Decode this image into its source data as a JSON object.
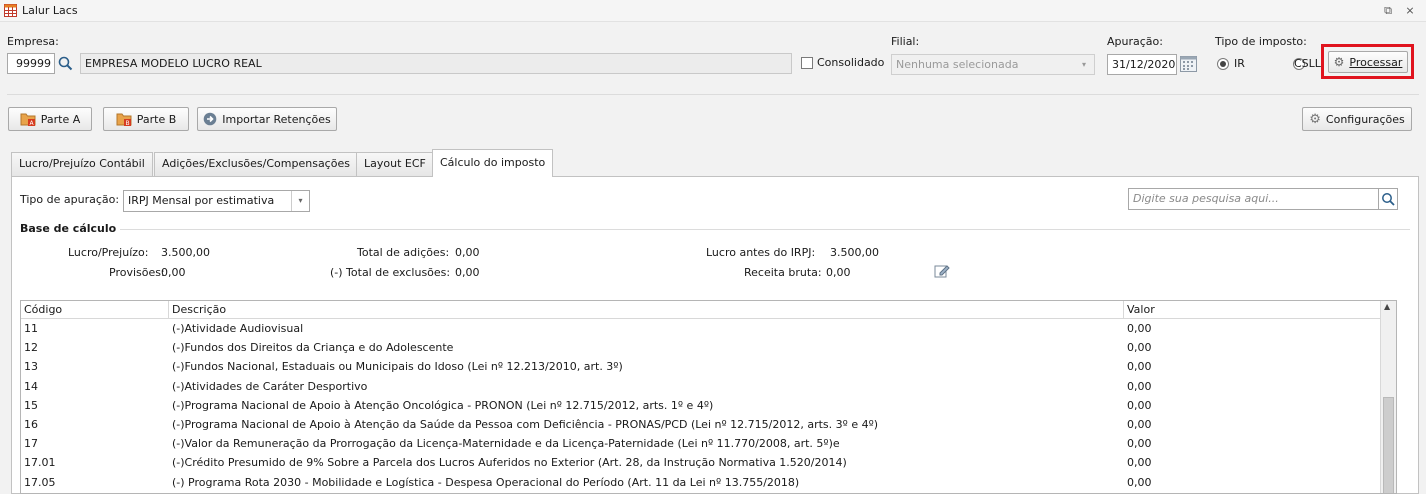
{
  "window": {
    "title": "Lalur Lacs",
    "restore_glyph": "⧉",
    "close_glyph": "⨯"
  },
  "header": {
    "empresa_label": "Empresa:",
    "empresa_code": "99999",
    "empresa_name": "EMPRESA MODELO LUCRO REAL",
    "consolidado_label": "Consolidado",
    "filial_label": "Filial:",
    "filial_placeholder": "Nenhuma selecionada",
    "apuracao_label": "Apuração:",
    "apuracao_value": "31/12/2020",
    "tipo_imposto_label": "Tipo de imposto:",
    "radio_ir": "IR",
    "radio_csll": "CSLL",
    "processar_label": "Processar"
  },
  "toolbar": {
    "parte_a": "Parte A",
    "parte_b": "Parte B",
    "importar": "Importar Retenções",
    "configuracoes": "Configurações"
  },
  "tabs": [
    {
      "label": "Lucro/Prejuízo Contábil"
    },
    {
      "label": "Adições/Exclusões/Compensações"
    },
    {
      "label": "Layout ECF"
    },
    {
      "label": "Cálculo do imposto"
    }
  ],
  "calc": {
    "tipo_apuracao_label": "Tipo de apuração:",
    "tipo_apuracao_value": "IRPJ Mensal por estimativa",
    "search_placeholder": "Digite sua pesquisa aqui...",
    "base_title": "Base de cálculo",
    "lucro_label": "Lucro/Prejuízo:",
    "lucro_value": "3.500,00",
    "provisoes_label": "Provisões:",
    "provisoes_value": "0,00",
    "total_adicoes_label": "Total de adições:",
    "total_adicoes_value": "0,00",
    "total_exclusoes_label": "(-) Total de exclusões:",
    "total_exclusoes_value": "0,00",
    "lucro_antes_label": "Lucro antes do IRPJ:",
    "lucro_antes_value": "3.500,00",
    "receita_label": "Receita bruta:",
    "receita_value": "0,00"
  },
  "grid": {
    "columns": [
      "Código",
      "Descrição",
      "Valor"
    ],
    "rows": [
      {
        "codigo": "11",
        "descricao": "(-)Atividade Audiovisual",
        "valor": "0,00"
      },
      {
        "codigo": "12",
        "descricao": "(-)Fundos dos Direitos da Criança e do Adolescente",
        "valor": "0,00"
      },
      {
        "codigo": "13",
        "descricao": "(-)Fundos Nacional, Estaduais ou Municipais do Idoso (Lei nº 12.213/2010, art. 3º)",
        "valor": "0,00"
      },
      {
        "codigo": "14",
        "descricao": "(-)Atividades de Caráter Desportivo",
        "valor": "0,00"
      },
      {
        "codigo": "15",
        "descricao": "(-)Programa Nacional de Apoio à Atenção Oncológica - PRONON (Lei nº 12.715/2012, arts. 1º e 4º)",
        "valor": "0,00"
      },
      {
        "codigo": "16",
        "descricao": "(-)Programa Nacional de Apoio à Atenção da Saúde da Pessoa com Deficiência - PRONAS/PCD (Lei nº 12.715/2012, arts. 3º e 4º)",
        "valor": "0,00"
      },
      {
        "codigo": "17",
        "descricao": "(-)Valor da Remuneração da Prorrogação da Licença-Maternidade e da Licença-Paternidade (Lei nº 11.770/2008, art. 5º)e",
        "valor": "0,00"
      },
      {
        "codigo": "17.01",
        "descricao": "(-)Crédito Presumido de 9% Sobre a Parcela dos Lucros Auferidos no Exterior (Art. 28, da Instrução Normativa 1.520/2014)",
        "valor": "0,00"
      },
      {
        "codigo": "17.05",
        "descricao": "(-) Programa Rota 2030 - Mobilidade e Logística - Despesa Operacional do Período (Art. 11 da Lei nº 13.755/2018)",
        "valor": "0,00"
      }
    ]
  },
  "colors": {
    "highlight": "#e0141e",
    "accent_icon": "#d84a1b"
  }
}
